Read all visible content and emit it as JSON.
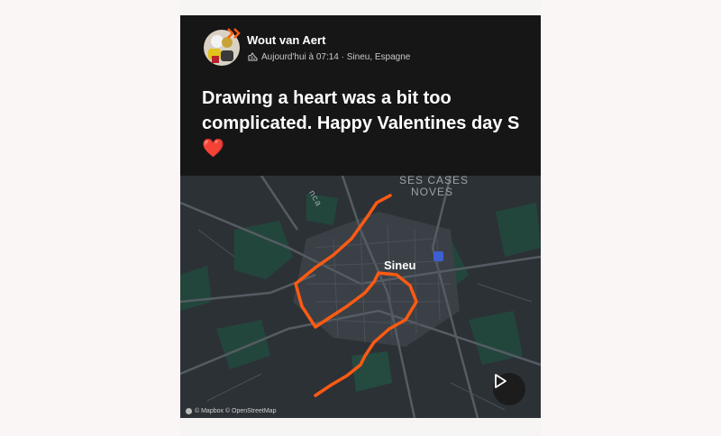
{
  "post": {
    "author": "Wout van Aert",
    "meta": "Aujourd'hui à 07:14 · Sineu, Espagne",
    "text": "Drawing a heart was a bit too complicated. Happy Valentines day S",
    "emoji": "❤️"
  },
  "map": {
    "label_line1": "SES CASES",
    "label_line2": "NOVES",
    "town": "Sineu",
    "road_label": "nca",
    "attribution": "© Mapbox © OpenStreetMap",
    "route_color": "#ff5a12"
  },
  "icons": {
    "avatar": "avatar-photo",
    "activity": "shoe-icon",
    "play": "play-icon",
    "poi": "poi-icon"
  }
}
